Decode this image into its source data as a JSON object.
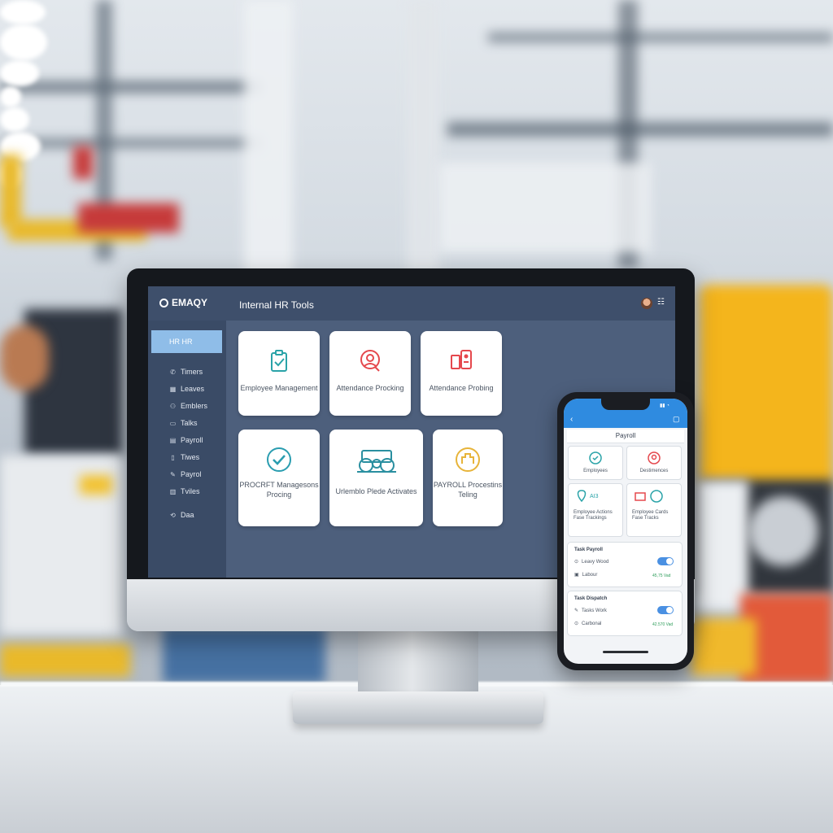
{
  "desktop": {
    "brand": "EMAQY",
    "brand_sub": "",
    "title": "Internal HR Tools",
    "sidebar": {
      "active": "HR HR",
      "items": [
        "Timers",
        "Leaves",
        "Emblers",
        "Talks",
        "Payroll",
        "Tiwes",
        "Payrol",
        "Tviles",
        "Daa"
      ],
      "icons": [
        "phone-icon",
        "calendar-icon",
        "users-icon",
        "chat-icon",
        "card-icon",
        "clock-icon",
        "edit-icon",
        "grid-icon",
        "refresh-icon"
      ]
    },
    "cards": [
      {
        "label": "Employee Management",
        "icon": "clipboard-icon",
        "color": "#2aa3a8"
      },
      {
        "label": "Attendance Procking",
        "icon": "face-scan-icon",
        "color": "#e5484d"
      },
      {
        "label": "Attendance Probing",
        "icon": "mobile-badge-icon",
        "color": "#e5484d"
      },
      {
        "label": "PROCRFT Managesons Procing",
        "icon": "check-circle-icon",
        "color": "#2a9db0"
      },
      {
        "label": "Urlemblo Plede Activates",
        "icon": "machinery-icon",
        "color": "#2a8fa0"
      },
      {
        "label": "PAYROLL Procestins Teling",
        "icon": "payroll-icon",
        "color": "#e7b43a"
      }
    ]
  },
  "phone": {
    "title": "Payroll",
    "tiles": [
      {
        "label": "Employees",
        "color": "#2aa3a8"
      },
      {
        "label": "Destimences",
        "color": "#e5484d"
      },
      {
        "label": "Employee Actions Fase Trackings",
        "color": "#2aa3a8"
      },
      {
        "label": "Employee Cards Fase Tracks",
        "color": "#e5484d"
      }
    ],
    "sections": [
      {
        "header": "Task Payroll",
        "rows": [
          {
            "label": "Leavy Wood",
            "right": ""
          },
          {
            "label": "Labour",
            "right": "45,75 Vad"
          }
        ]
      },
      {
        "header": "Task Dispatch",
        "rows": [
          {
            "label": "Tasks Work",
            "right": ""
          },
          {
            "label": "Carbonal",
            "right": "42.570 Vad"
          }
        ]
      }
    ]
  }
}
